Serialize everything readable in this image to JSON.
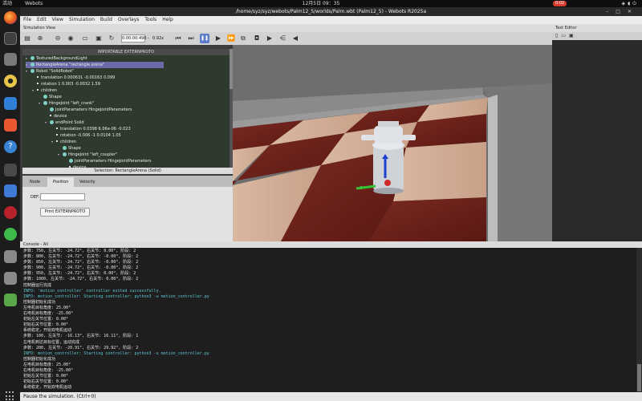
{
  "os": {
    "activities": "活动",
    "app_name": "Webots",
    "clock": "12月5日 09：35",
    "record_label": "0:02",
    "tray_icons": [
      "network-icon",
      "volume-icon",
      "power-icon"
    ]
  },
  "dock": [
    "firefox-icon",
    "terminal-icon",
    "files-icon",
    "rhythmbox-icon",
    "writer-icon",
    "appcenter-icon",
    "help-icon",
    "terminal2-icon",
    "editor-icon",
    "webots-icon",
    "wechat-icon",
    "disk-icon",
    "disk2-icon",
    "trash-icon"
  ],
  "window": {
    "title": "/home/syz/syz/webots/Palm12_5/worlds/Palm.wbt (Palm12_5) - Webots R2025a"
  },
  "menu": [
    "File",
    "Edit",
    "View",
    "Simulation",
    "Build",
    "Overlays",
    "Tools",
    "Help"
  ],
  "panels": {
    "simulation_view": "Simulation View",
    "text_editor": "Text Editor",
    "console": "Console - All"
  },
  "toolbar": {
    "time": "0:00:00:496",
    "speed": "0.92x"
  },
  "scene_tree": {
    "proto_header": "IMPORTABLE EXTERNPROTO",
    "nodes": [
      {
        "label": "TexturedBackgroundLight",
        "kind": "dot",
        "indent": 0
      },
      {
        "label": "RectangleArena \"rectangle arena\"",
        "kind": "dot",
        "indent": 0
      },
      {
        "label": "Robot \"SolidRobot\"",
        "kind": "dot",
        "indent": 0
      },
      {
        "label": "translation 0.000631 -0.00163 0.099",
        "kind": "bullet",
        "indent": 1
      },
      {
        "label": "rotation 1 0.003 -0.0032 1.59",
        "kind": "bullet",
        "indent": 1
      },
      {
        "label": "children",
        "kind": "bullet",
        "indent": 1
      },
      {
        "label": "Shape",
        "kind": "dot",
        "indent": 2
      },
      {
        "label": "HingeJoint \"left_crank\"",
        "kind": "dot",
        "indent": 2
      },
      {
        "label": "JointParameters HingeJointParameters",
        "kind": "dot",
        "indent": 3
      },
      {
        "label": "device",
        "kind": "bullet",
        "indent": 3
      },
      {
        "label": "endPoint Solid",
        "kind": "dot",
        "indent": 3
      },
      {
        "label": "translation 0.0398 6.06e-06 -0.023",
        "kind": "bullet",
        "indent": 4
      },
      {
        "label": "rotation -0.006 -1 0.0104 1.05",
        "kind": "bullet",
        "indent": 4
      },
      {
        "label": "children",
        "kind": "bullet",
        "indent": 4
      },
      {
        "label": "Shape",
        "kind": "dot",
        "indent": 5
      },
      {
        "label": "HingeJoint \"left_coupler\"",
        "kind": "dot",
        "indent": 5
      },
      {
        "label": "JointParameters HingeJointParameters",
        "kind": "dot",
        "indent": 6
      },
      {
        "label": "device",
        "kind": "bullet",
        "indent": 6
      }
    ]
  },
  "selection": {
    "title": "Selection: RectangleArena (Solid)",
    "tabs": [
      "Node",
      "Position",
      "Velocity"
    ],
    "def_label": "DEF:",
    "print_button": "Print EXTERNPROTO"
  },
  "console_lines": [
    {
      "t": "步数: 750, 左关节: -24.72°, 右关节: 0.00°, 阶段: 2",
      "c": "n"
    },
    {
      "t": "步数: 800, 左关节: -24.72°, 右关节: -0.00°, 阶段: 2",
      "c": "n"
    },
    {
      "t": "步数: 850, 左关节: -24.72°, 右关节: -0.00°, 阶段: 2",
      "c": "n"
    },
    {
      "t": "步数: 900, 左关节: -24.72°, 右关节: -0.00°, 阶段: 2",
      "c": "n"
    },
    {
      "t": "步数: 950, 左关节: -24.72°, 右关节: 0.00°, 阶段: 2",
      "c": "n"
    },
    {
      "t": "步数: 1000, 左关节: -24.72°, 右关节: 0.00°, 阶段: 2",
      "c": "n"
    },
    {
      "t": "控制器运行完成",
      "c": "n"
    },
    {
      "t": "INFO: 'motion_controller' controller exited successfully.",
      "c": "i"
    },
    {
      "t": "INFO: motion_controller: Starting controller: python3 -u motion_controller.py",
      "c": "i"
    },
    {
      "t": "控制器初始化成功",
      "c": "n"
    },
    {
      "t": "左电机目标角度: 25.00°",
      "c": "n"
    },
    {
      "t": "右电机目标角度: -25.00°",
      "c": "n"
    },
    {
      "t": "初始左关节位置: 0.00°",
      "c": "n"
    },
    {
      "t": "初始右关节位置: 0.00°",
      "c": "n"
    },
    {
      "t": "系统稳定，开始双电机运动",
      "c": "n"
    },
    {
      "t": "步数: 100, 左关节: -16.13°, 右关节: 16.11°, 阶段: 1",
      "c": "n"
    },
    {
      "t": "左电机到达目标位置，运动完成",
      "c": "n"
    },
    {
      "t": "步数: 200, 左关节: -20.91°, 右关节: 29.92°, 阶段: 2",
      "c": "n"
    },
    {
      "t": "INFO: motion_controller: Starting controller: python3 -u motion_controller.py",
      "c": "i"
    },
    {
      "t": "控制器初始化成功",
      "c": "n"
    },
    {
      "t": "左电机目标角度: 25.00°",
      "c": "n"
    },
    {
      "t": "右电机目标角度: -25.00°",
      "c": "n"
    },
    {
      "t": "初始左关节位置: 0.00°",
      "c": "n"
    },
    {
      "t": "初始右关节位置: 0.00°",
      "c": "n"
    },
    {
      "t": "系统稳定，开始双电机运动",
      "c": "n"
    }
  ],
  "status": "Pause the simulation. (Ctrl+0)"
}
